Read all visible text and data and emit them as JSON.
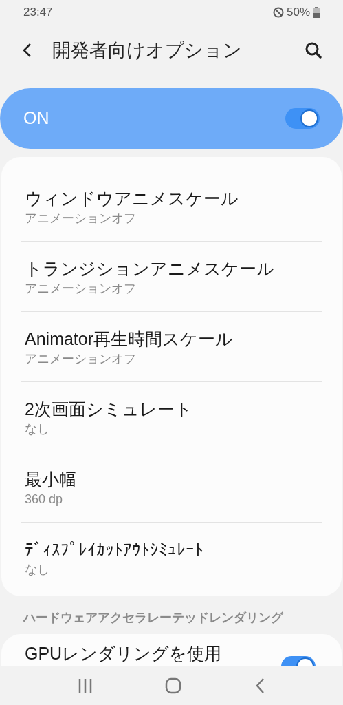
{
  "status_bar": {
    "time": "23:47",
    "battery": "50%"
  },
  "header": {
    "title": "開発者向けオプション"
  },
  "master_switch": {
    "label": "ON",
    "on": true
  },
  "items": [
    {
      "title": "ウィンドウアニメスケール",
      "summary": "アニメーションオフ"
    },
    {
      "title": "トランジションアニメスケール",
      "summary": "アニメーションオフ"
    },
    {
      "title": "Animator再生時間スケール",
      "summary": "アニメーションオフ"
    },
    {
      "title": "2次画面シミュレート",
      "summary": "なし"
    },
    {
      "title": "最小幅",
      "summary": "360 dp"
    },
    {
      "title": "ﾃﾞｨｽﾌﾟﾚｲｶｯﾄｱｳﾄｼﾐｭﾚｰﾄ",
      "summary": "なし"
    }
  ],
  "section": {
    "title": "ハードウェアアクセラレーテッドレンダリング",
    "items": [
      {
        "title": "GPUレンダリングを使用",
        "on": true
      }
    ]
  }
}
